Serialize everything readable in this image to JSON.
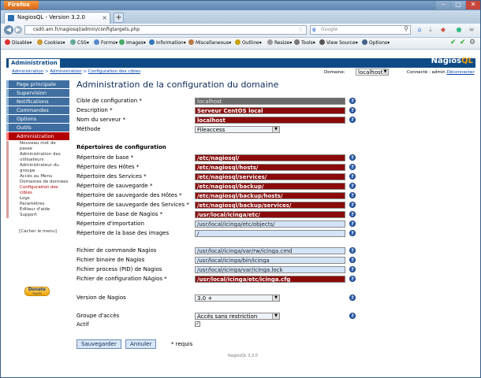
{
  "browser": {
    "menu_button": "Firefox",
    "tab_title": "NagiosQL - Version 3.2.0",
    "url": "csd0.am.fr/nagiosql/admin/configtargets.php",
    "search_placeholder": "Google",
    "window_controls": [
      "–",
      "□",
      "✕"
    ]
  },
  "toolbar": {
    "items": [
      "Disable",
      "Cookies",
      "CSS",
      "Forms",
      "Images",
      "Information",
      "Miscellaneous",
      "Outline",
      "Resize",
      "Tools",
      "View Source",
      "Options"
    ]
  },
  "app": {
    "tab": "Administration",
    "logo_main": "Nagios",
    "logo_accent": "QL",
    "breadcrumb": [
      "Administration",
      "Administration",
      "Configuration des cibles"
    ],
    "breadcrumb_sep": ">",
    "domain_label": "Domaine:",
    "domain_value": "localhost",
    "user_text": "Connecté : admin",
    "logout": "Déconnecter"
  },
  "sidebar": {
    "main": [
      "Page principale",
      "Supervision",
      "Notifications",
      "Commandes",
      "Options",
      "Outils"
    ],
    "active": "Administration",
    "sub": [
      "Nouveau mot de passe",
      "Administration des utilisateurs",
      "Administrateur du groupe",
      "Accès au Menu",
      "Domaines de données",
      "Configuration des cibles",
      "Logs",
      "Paramètres",
      "Editeur d'aide",
      "Support"
    ],
    "hide_menu": "[Cacher le menu]",
    "donate": "Donate",
    "donate_sub": "PayPal"
  },
  "main": {
    "title": "Administration de la configuration du domaine",
    "fields1": [
      {
        "label": "Cible de configuration *",
        "value": "localhost",
        "style": "gray"
      },
      {
        "label": "Description *",
        "value": "Serveur CentOS local",
        "style": "red"
      },
      {
        "label": "Nom du serveur *",
        "value": "localhost",
        "style": "red"
      }
    ],
    "method_label": "Méthode",
    "method_value": "Fileaccess",
    "section_title": "Répertoires de configuration",
    "dirs": [
      {
        "label": "Répertoire de base *",
        "value": "/etc/nagiosql/",
        "style": "red"
      },
      {
        "label": "Répertoire des Hôtes *",
        "value": "/etc/nagiosql/hosts/",
        "style": "red"
      },
      {
        "label": "Répertoire des Services *",
        "value": "/etc/nagiosql/services/",
        "style": "red"
      },
      {
        "label": "Répertoire de sauvegarde *",
        "value": "/etc/nagiosql/backup/",
        "style": "red"
      },
      {
        "label": "Répertoire de sauvegarde des Hôtes *",
        "value": "/etc/nagiosql/backup/hosts/",
        "style": "red"
      },
      {
        "label": "Répertoire de sauvegarde des Services *",
        "value": "/etc/nagiosql/backup/services/",
        "style": "red"
      },
      {
        "label": "Répertoire de base de Nagios *",
        "value": "/usr/local/icinga/etc/",
        "style": "red"
      },
      {
        "label": "Répertoire d'importation",
        "value": "/usr/local/icinga/etc/objects/",
        "style": "blue"
      },
      {
        "label": "Répertoire de la base des images",
        "value": "/",
        "style": "blue"
      }
    ],
    "files": [
      {
        "label": "Fichier de commande Nagios",
        "value": "/usr/local/icinga/var/rw/icinga.cmd",
        "style": "blue"
      },
      {
        "label": "Fichier binaire de Nagios",
        "value": "/usr/local/icinga/bin/icinga",
        "style": "blue"
      },
      {
        "label": "Fichier process (PID) de Nagios",
        "value": "/usr/local/icinga/var/icinga.lock",
        "style": "blue"
      },
      {
        "label": "Fichier de configuration NAgios *",
        "value": "/usr/local/icinga/etc/icinga.cfg",
        "style": "red"
      }
    ],
    "version_label": "Version de Nagios",
    "version_value": "3.0 +",
    "group_label": "Groupe d'accès",
    "group_value": "Accès sans restriction",
    "active_label": "Actif",
    "active_checked": "✓",
    "save": "Sauvegarder",
    "cancel": "Annuler",
    "required_note": "* requis",
    "footer_version": "NagiosQL 3.2.0"
  }
}
